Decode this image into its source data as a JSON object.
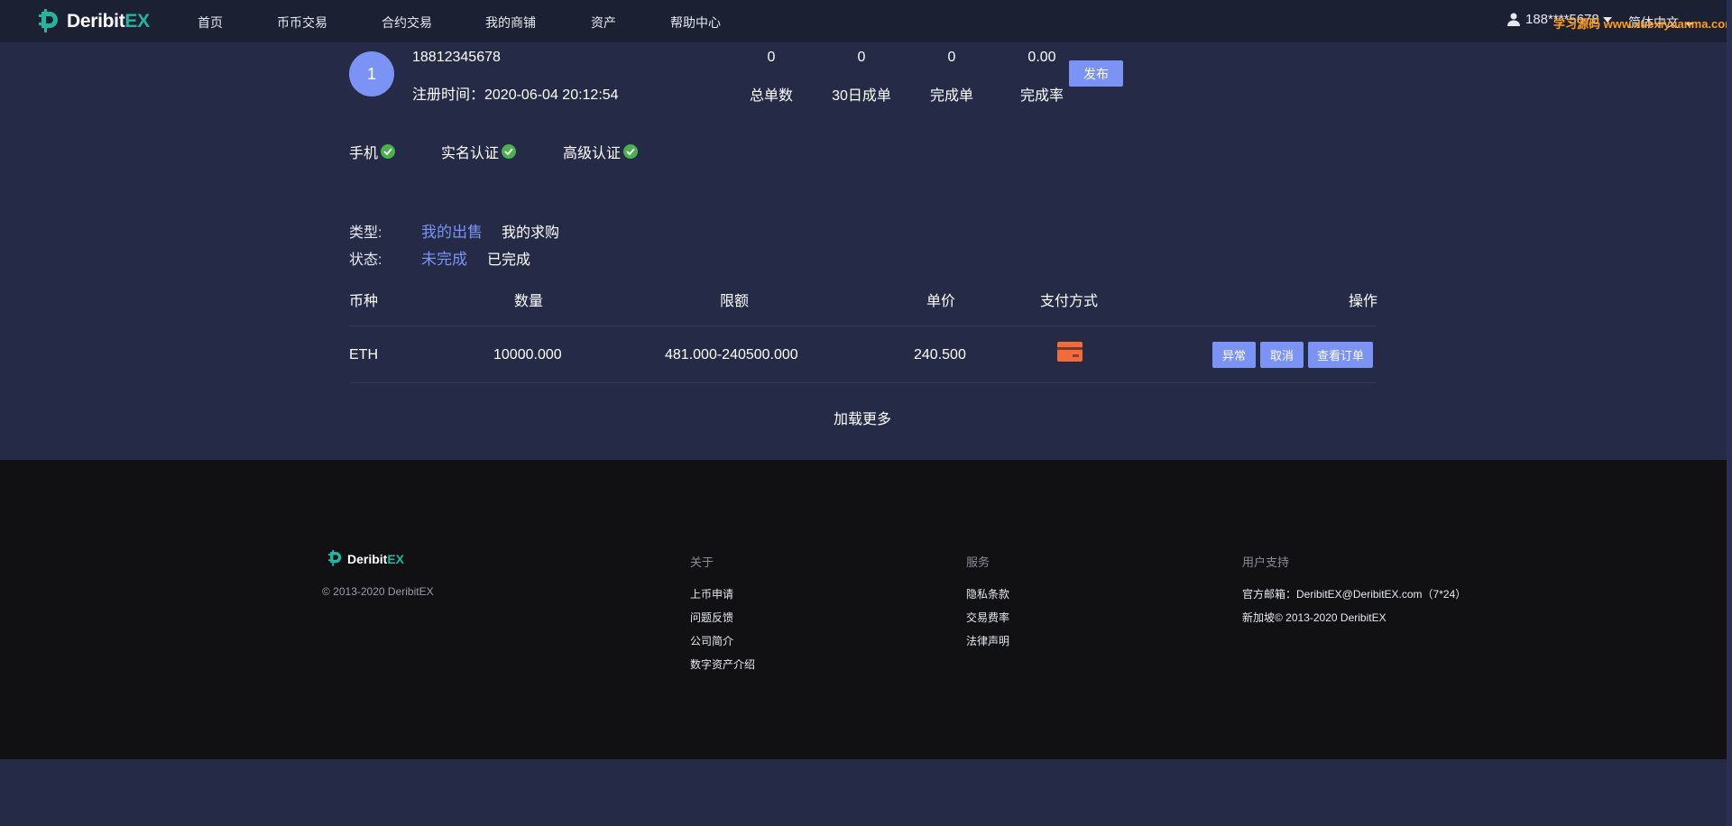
{
  "header": {
    "brand": "Deribit",
    "brand_suffix": "EX",
    "nav": [
      "首页",
      "币币交易",
      "合约交易",
      "我的商铺",
      "资产",
      "帮助中心"
    ],
    "user": "188****5678",
    "language": "简体中文",
    "watermark": "学习源码 www.xuexiyuanma.com"
  },
  "profile": {
    "avatar_text": "1",
    "phone": "18812345678",
    "reg_time": "注册时间：2020-06-04 20:12:54",
    "stats": [
      {
        "value": "0",
        "label": "总单数"
      },
      {
        "value": "0",
        "label": "30日成单"
      },
      {
        "value": "0",
        "label": "完成单"
      },
      {
        "value": "0.00",
        "label": "完成率"
      }
    ],
    "publish_label": "发布",
    "verifications": [
      "手机",
      "实名认证",
      "高级认证"
    ]
  },
  "filters": {
    "type_label": "类型:",
    "type_options": [
      "我的出售",
      "我的求购"
    ],
    "status_label": "状态:",
    "status_options": [
      "未完成",
      "已完成"
    ]
  },
  "table": {
    "headers": [
      "币种",
      "数量",
      "限额",
      "单价",
      "支付方式",
      "操作"
    ],
    "rows": [
      {
        "coin": "ETH",
        "amount": "10000.000",
        "limit": "481.000-240500.000",
        "price": "240.500",
        "payment_icon": "bank-card-icon",
        "actions": [
          "异常",
          "取消",
          "查看订单"
        ]
      }
    ],
    "load_more": "加载更多"
  },
  "footer": {
    "brand": "Deribit",
    "brand_suffix": "EX",
    "copyright": "© 2013-2020 DeribitEX",
    "columns": [
      {
        "title": "关于",
        "links": [
          "上币申请",
          "问题反馈",
          "公司简介",
          "数字资产介绍"
        ]
      },
      {
        "title": "服务",
        "links": [
          "隐私条款",
          "交易费率",
          "法律声明"
        ]
      },
      {
        "title": "用户支持",
        "links": [
          "官方邮箱：DeribitEX@DeribitEX.com（7*24）",
          "新加坡© 2013-2020 DeribitEX"
        ]
      }
    ]
  },
  "colors": {
    "accent": "#7b93f5",
    "brand_green": "#25b49e",
    "check_green": "#4caf50",
    "card_orange": "#f26b3a",
    "page_bg": "#252a46",
    "footer_bg": "#111114"
  }
}
